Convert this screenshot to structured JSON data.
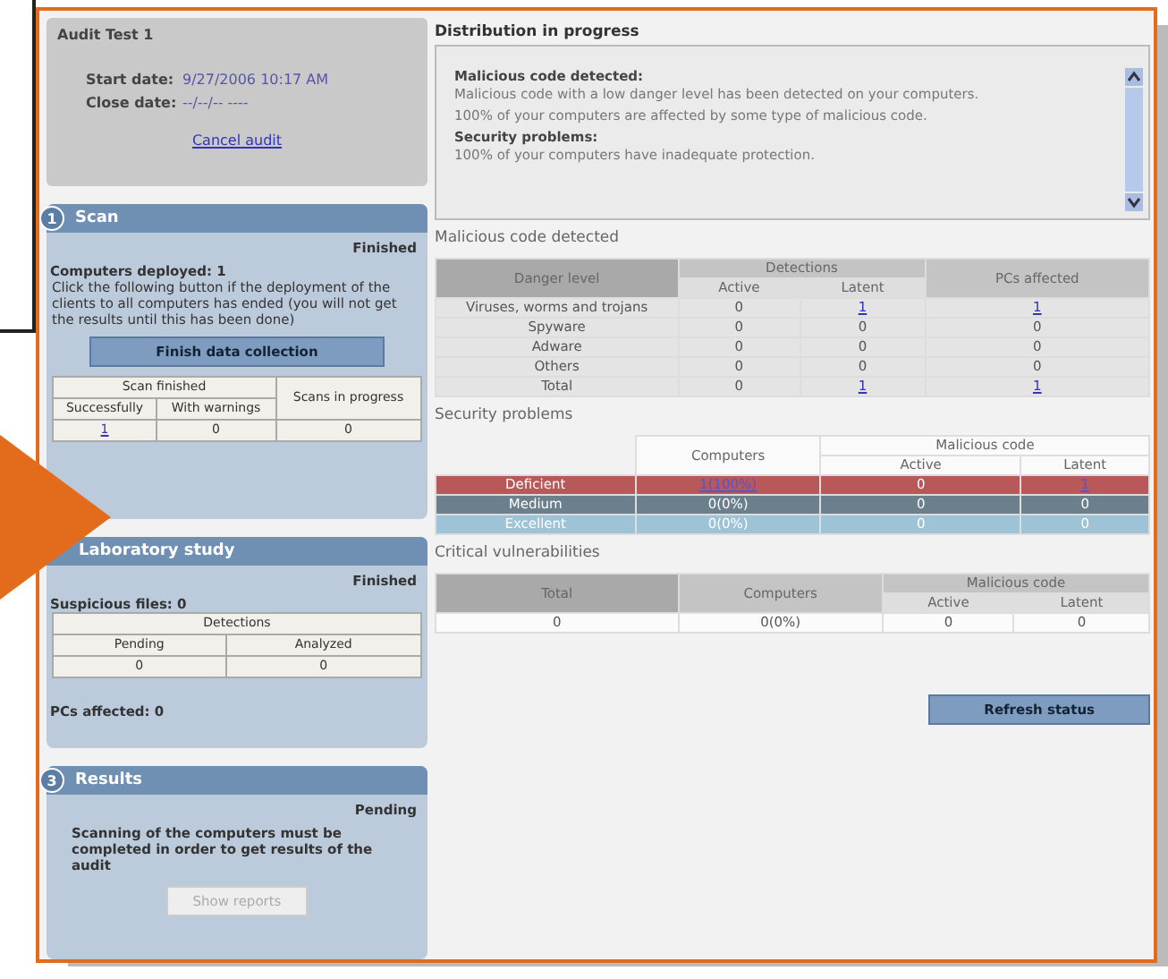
{
  "audit": {
    "title": "Audit Test 1",
    "start_label": "Start date:",
    "start_value": "9/27/2006 10:17 AM",
    "close_label": "Close date:",
    "close_value": "--/--/-- ----",
    "cancel_link": "Cancel audit"
  },
  "steps": [
    {
      "number": "1",
      "title": "Scan",
      "status": "Finished",
      "kind": "scan",
      "heading": "Computers deployed: 1",
      "text": "Click the following button if the deployment of the clients to all computers has ended (you will not get the results until this has been done)",
      "button": {
        "label": "Finish data collection",
        "disabled": false
      },
      "table": {
        "group": "Scan finished",
        "columns": [
          "Successfully",
          "With warnings"
        ],
        "side": "Scans in progress",
        "values": [
          {
            "text": "1",
            "link": true
          },
          {
            "text": "0",
            "link": false
          },
          {
            "text": "0",
            "link": false
          }
        ]
      }
    },
    {
      "title": "Laboratory study",
      "status": "Finished",
      "kind": "lab",
      "heading": "Suspicious files: 0",
      "table": {
        "group": "Detections",
        "columns": [
          "Pending",
          "Analyzed"
        ],
        "values": [
          {
            "text": "0",
            "link": false
          },
          {
            "text": "0",
            "link": false
          }
        ]
      },
      "footer": "PCs affected: 0"
    },
    {
      "number": "3",
      "title": "Results",
      "status": "Pending",
      "kind": "results",
      "text": "Scanning of the computers must be completed in order to get results of the audit",
      "button": {
        "label": "Show reports",
        "disabled": true
      }
    }
  ],
  "distribution": {
    "title": "Distribution in progress",
    "messages": [
      {
        "kind": "heading",
        "text": "Malicious code detected:"
      },
      {
        "kind": "text",
        "text": "Malicious code with a low danger level has been detected on your computers."
      },
      {
        "kind": "text",
        "text": "100% of your computers are affected by some type of malicious code."
      },
      {
        "kind": "heading",
        "text": "Security problems:"
      },
      {
        "kind": "text",
        "text": "100% of your computers have inadequate protection."
      }
    ]
  },
  "malicious": {
    "title": "Malicious code detected",
    "columns": {
      "level": "Danger level",
      "group": "Detections",
      "active": "Active",
      "latent": "Latent",
      "pcs": "PCs affected"
    },
    "rows": [
      {
        "cells": [
          {
            "text": "Viruses, worms and trojans",
            "link": false
          },
          {
            "text": "0",
            "link": false
          },
          {
            "text": "1",
            "link": true
          },
          {
            "text": "1",
            "link": true
          }
        ]
      },
      {
        "cells": [
          {
            "text": "Spyware",
            "link": false
          },
          {
            "text": "0",
            "link": false
          },
          {
            "text": "0",
            "link": false
          },
          {
            "text": "0",
            "link": false
          }
        ]
      },
      {
        "cells": [
          {
            "text": "Adware",
            "link": false
          },
          {
            "text": "0",
            "link": false
          },
          {
            "text": "0",
            "link": false
          },
          {
            "text": "0",
            "link": false
          }
        ]
      },
      {
        "cells": [
          {
            "text": "Others",
            "link": false
          },
          {
            "text": "0",
            "link": false
          },
          {
            "text": "0",
            "link": false
          },
          {
            "text": "0",
            "link": false
          }
        ]
      },
      {
        "cells": [
          {
            "text": "Total",
            "link": false
          },
          {
            "text": "0",
            "link": false
          },
          {
            "text": "1",
            "link": true
          },
          {
            "text": "1",
            "link": true
          }
        ]
      }
    ]
  },
  "security": {
    "title": "Security problems",
    "columns": {
      "computers": "Computers",
      "group": "Malicious code",
      "active": "Active",
      "latent": "Latent"
    },
    "rows": [
      {
        "color": "#b85858",
        "cells": [
          {
            "text": "Deficient",
            "link": false
          },
          {
            "text": "1(100%)",
            "link": true
          },
          {
            "text": "0",
            "link": false
          },
          {
            "text": "1",
            "link": true
          }
        ]
      },
      {
        "color": "#6b7f8c",
        "cells": [
          {
            "text": "Medium",
            "link": false
          },
          {
            "text": "0(0%)",
            "link": false
          },
          {
            "text": "0",
            "link": false
          },
          {
            "text": "0",
            "link": false
          }
        ]
      },
      {
        "color": "#9ec3d6",
        "cells": [
          {
            "text": "Excellent",
            "link": false
          },
          {
            "text": "0(0%)",
            "link": false
          },
          {
            "text": "0",
            "link": false
          },
          {
            "text": "0",
            "link": false
          }
        ]
      }
    ]
  },
  "critical": {
    "title": "Critical vulnerabilities",
    "columns": {
      "total": "Total",
      "computers": "Computers",
      "group": "Malicious code",
      "active": "Active",
      "latent": "Latent"
    },
    "rows": [
      {
        "cells": [
          {
            "text": "0",
            "link": false
          },
          {
            "text": "0(0%)",
            "link": false
          },
          {
            "text": "0",
            "link": false
          },
          {
            "text": "0",
            "link": false
          }
        ]
      }
    ]
  },
  "refresh_button": "Refresh status"
}
